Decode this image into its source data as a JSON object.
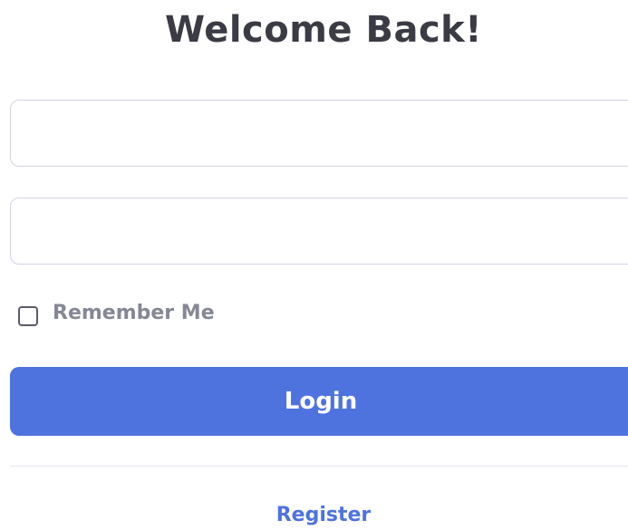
{
  "heading": "Welcome Back!",
  "form": {
    "email": {
      "value": "",
      "placeholder": ""
    },
    "password": {
      "value": "",
      "placeholder": ""
    },
    "remember_label": "Remember Me",
    "remember_checked": false,
    "login_label": "Login"
  },
  "footer": {
    "register_label": "Register"
  },
  "colors": {
    "primary": "#4e73df",
    "heading": "#3a3b45",
    "muted": "#858796",
    "border": "#d1d3e2"
  }
}
